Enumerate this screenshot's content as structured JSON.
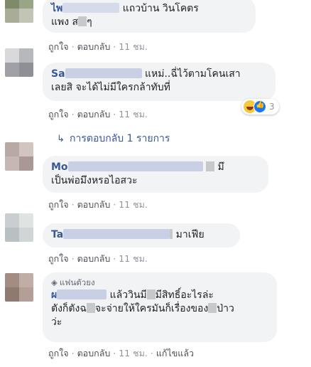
{
  "actions": {
    "like": "ถูกใจ",
    "reply": "ตอบกลับ",
    "edited": "แก้ไขแล้ว",
    "separator": "·"
  },
  "comments": [
    {
      "name_prefix": "ไพ",
      "line1": "แถวบ้าน วินโคตร",
      "line2_a": "แพง ส",
      "line2_b": "ๆ",
      "time": "11 ชม."
    },
    {
      "name_prefix": "Sa",
      "line1": "แหม่..ฉี่ไว้ตามโคนเสา",
      "line2": "เลยสิ จะได้ไม่มีใครกล้าทับที่",
      "time": "11 ชม.",
      "reaction_count": "3",
      "reaction_icons": [
        "haha-icon",
        "like-icon"
      ]
    },
    {
      "name_prefix": "Mo",
      "line1_tail": "มึ",
      "line2": "เป็นพ่อมึงหรอไอสวะ",
      "time": "11 ชม."
    },
    {
      "name_prefix": "Ta",
      "line1": "มาเฟีย",
      "time": "11 ชม."
    },
    {
      "badge": "แฟนตัวยง",
      "line1_prefix": "ผ",
      "line1_a": "แล้ววินมี",
      "line1_b": "มีสิทธิ์อะไรล่ะ",
      "line2_a": "ตังก็ตังฉ",
      "line2_b": "จะจ่ายให้ใครมันก็เรื่องของ",
      "line2_c": "ป่าว",
      "line3": "ว่ะ",
      "time": "11 ชม."
    }
  ],
  "reply_link": "การตอบกลับ 1 รายการ",
  "colors": {
    "link": "#385898",
    "bubble": "#f2f3f5",
    "meta": "#90949c"
  }
}
